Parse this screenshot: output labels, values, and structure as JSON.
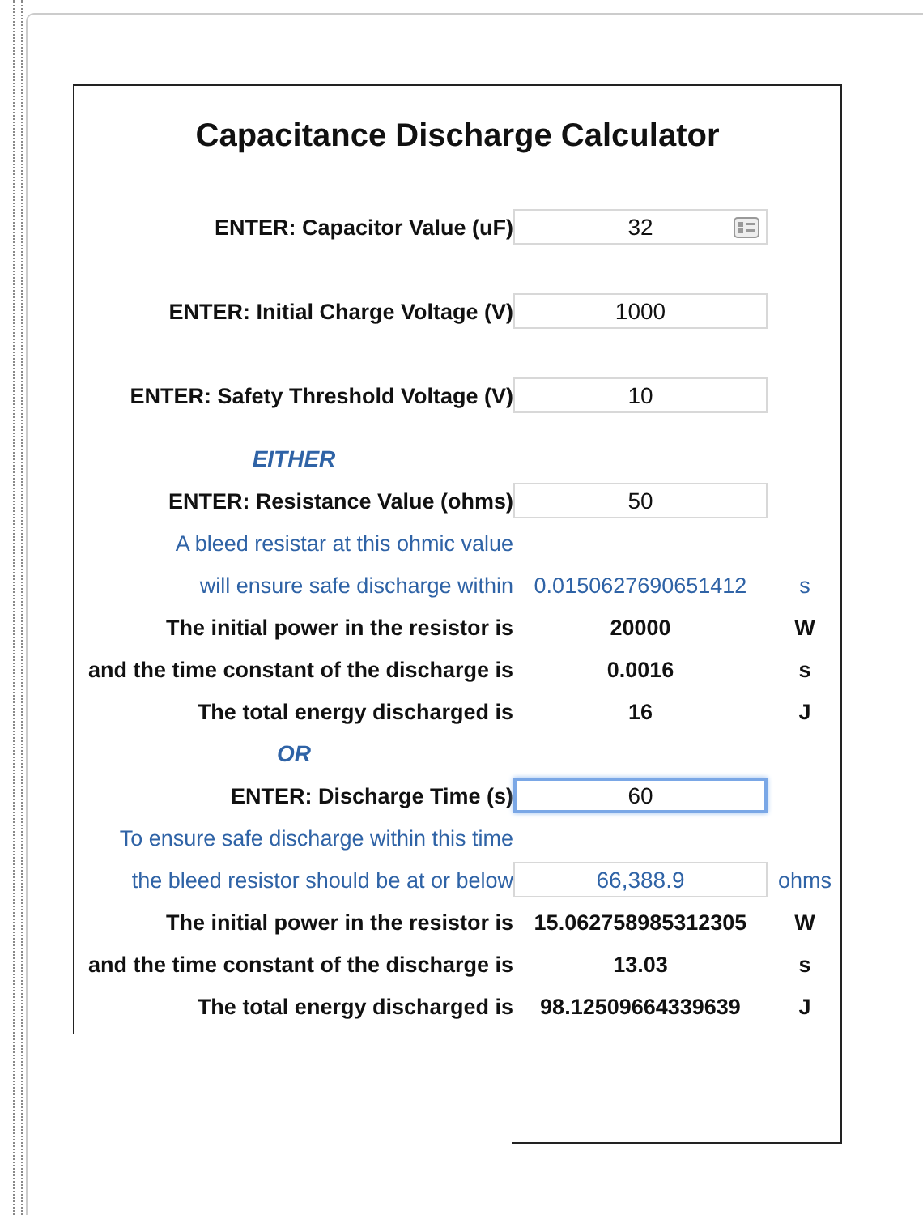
{
  "title": "Capacitance Discharge Calculator",
  "setup_fields": [
    {
      "label": "ENTER: Capacitor Value (uF)",
      "value": "32",
      "focused": false,
      "card_icon": true
    },
    {
      "label": "ENTER: Initial Charge Voltage (V)",
      "value": "1000",
      "focused": false,
      "card_icon": false
    },
    {
      "label": "ENTER: Safety Threshold Voltage (V)",
      "value": "10",
      "focused": false,
      "card_icon": false
    }
  ],
  "sections": [
    {
      "heading": "EITHER",
      "rows": [
        {
          "kind": "input",
          "label": "ENTER: Resistance Value (ohms)",
          "value": "50",
          "focused": false
        },
        {
          "kind": "note",
          "label": "A bleed resistar at this ohmic value"
        },
        {
          "kind": "note",
          "label": "will ensure safe discharge within",
          "value": "0.0150627690651412",
          "unit": "s"
        },
        {
          "kind": "result",
          "label": "The initial power in the resistor is",
          "value": "20000",
          "unit": "W"
        },
        {
          "kind": "result",
          "label": "and the time constant of the discharge is",
          "value": "0.0016",
          "unit": "s"
        },
        {
          "kind": "result",
          "label": "The total energy discharged is",
          "value": "16",
          "unit": "J"
        }
      ]
    },
    {
      "heading": "OR",
      "rows": [
        {
          "kind": "input",
          "label": "ENTER: Discharge Time (s)",
          "value": "60",
          "focused": true
        },
        {
          "kind": "note",
          "label": "To ensure safe discharge within this time"
        },
        {
          "kind": "output",
          "label": "the bleed resistor should be at or below",
          "value": "66,388.9",
          "unit": "ohms"
        },
        {
          "kind": "result",
          "label": "The initial power in the resistor is",
          "value": "15.062758985312305",
          "unit": "W"
        },
        {
          "kind": "result",
          "label": "and the time constant of the discharge is",
          "value": "13.03",
          "unit": "s"
        },
        {
          "kind": "result",
          "label": "The total energy discharged is",
          "value": "98.12509664339639",
          "unit": "J"
        }
      ]
    }
  ]
}
